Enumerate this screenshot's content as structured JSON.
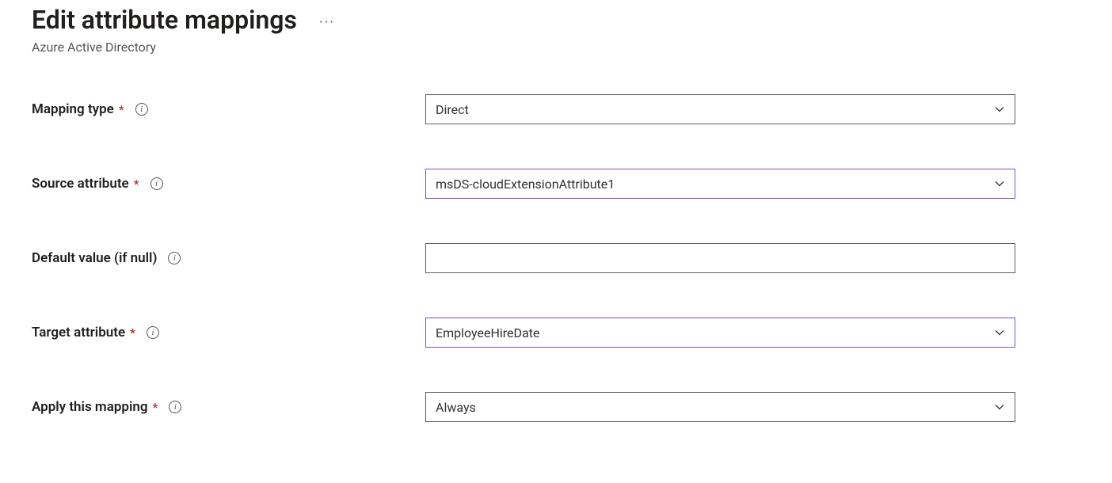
{
  "header": {
    "title": "Edit attribute mappings",
    "subtitle": "Azure Active Directory",
    "more": "···"
  },
  "fields": {
    "mapping_type": {
      "label": "Mapping type",
      "required": "*",
      "value": "Direct"
    },
    "source_attribute": {
      "label": "Source attribute",
      "required": "*",
      "value": "msDS-cloudExtensionAttribute1"
    },
    "default_value": {
      "label": "Default value (if null)",
      "value": ""
    },
    "target_attribute": {
      "label": "Target attribute",
      "required": "*",
      "value": "EmployeeHireDate"
    },
    "apply_mapping": {
      "label": "Apply this mapping",
      "required": "*",
      "value": "Always"
    }
  },
  "icons": {
    "info": "i"
  }
}
